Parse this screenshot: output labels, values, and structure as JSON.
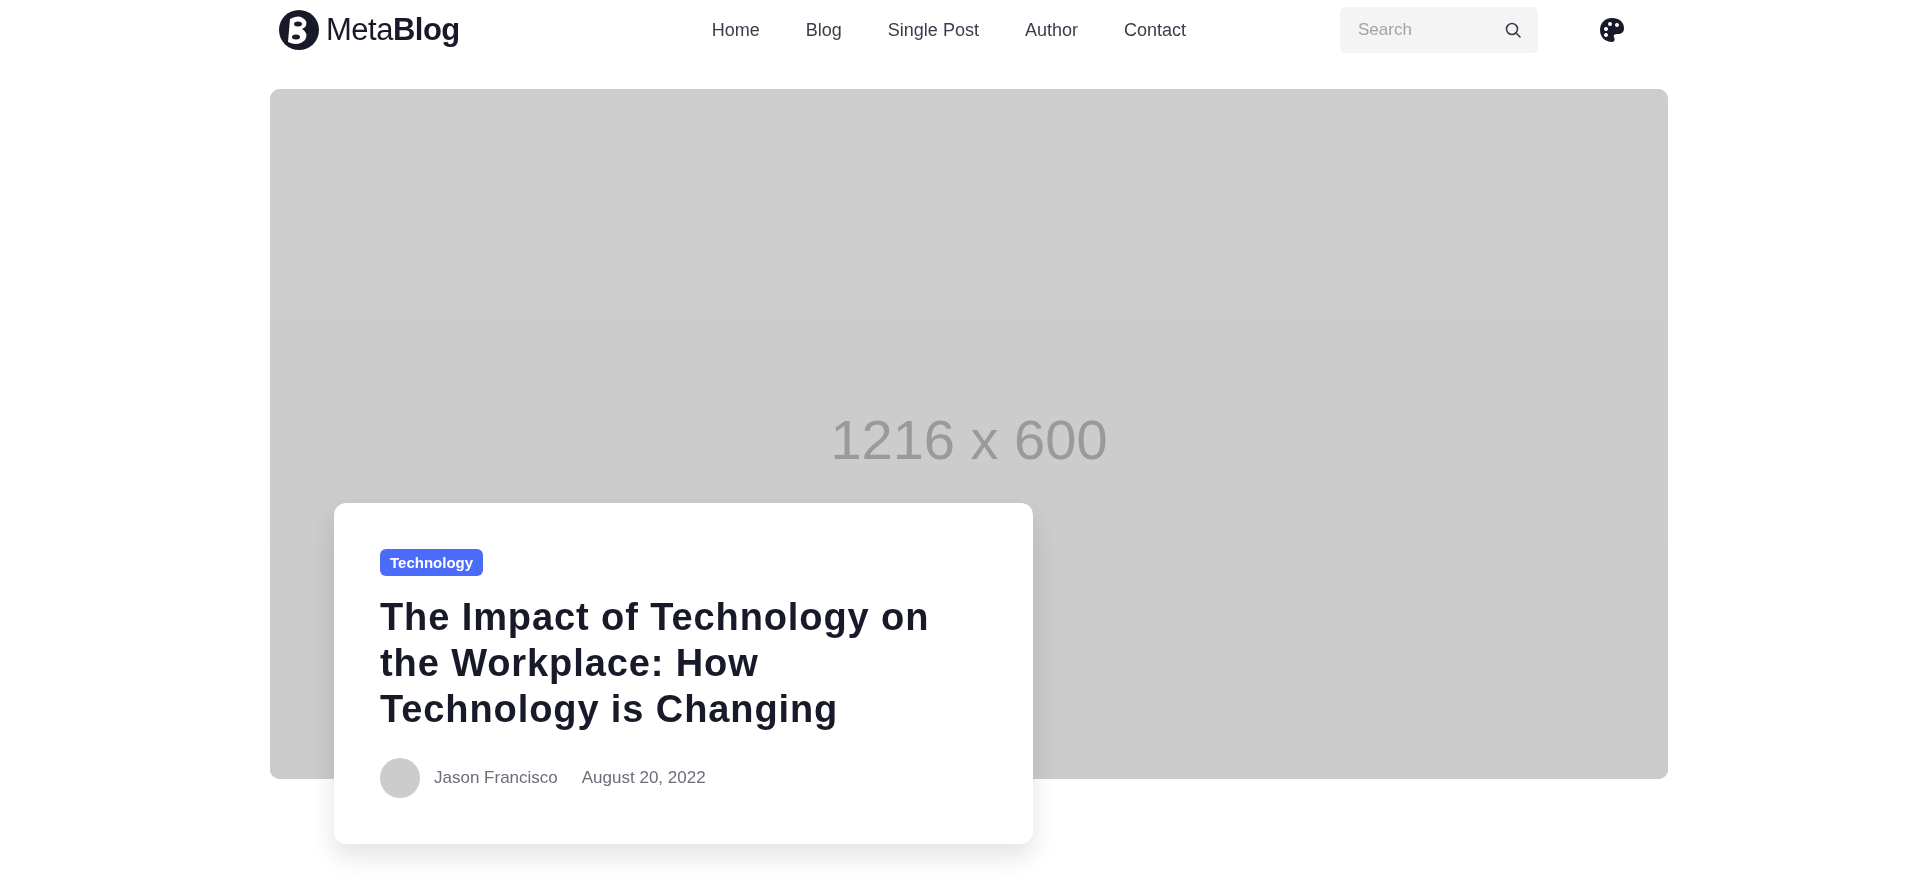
{
  "header": {
    "logo": "Meta**Blog**",
    "nav": [
      {
        "label": "Home"
      },
      {
        "label": "Blog"
      },
      {
        "label": "Single Post"
      },
      {
        "label": "Author"
      },
      {
        "label": "Contact"
      }
    ],
    "search": {
      "placeholder": "Search"
    }
  },
  "hero": {
    "image": {
      "kind": "picture",
      "placeholder_label": "1216 x 600"
    },
    "card": {
      "tag": "Technology",
      "title": "The Impact of Technology on the Workplace: How Technology is Changing",
      "author": "Jason Francisco",
      "date": "August 20, 2022"
    }
  }
}
